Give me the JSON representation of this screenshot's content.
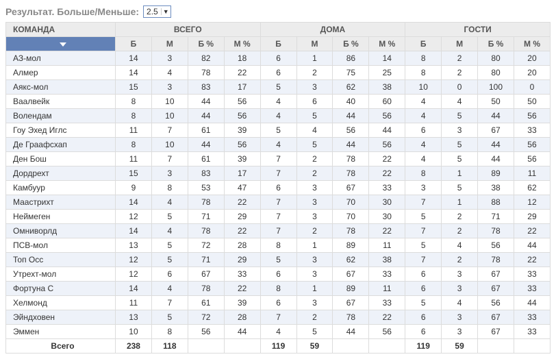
{
  "header": {
    "title": "Результат. Больше/Меньше:",
    "select_value": "2.5"
  },
  "columns": {
    "team": "КОМАНДА",
    "groups": [
      "ВСЕГО",
      "ДОМА",
      "ГОСТИ"
    ],
    "sub": [
      "Б",
      "М",
      "Б %",
      "М %"
    ]
  },
  "rows": [
    {
      "team": "АЗ-мол",
      "all": [
        14,
        3,
        82,
        18
      ],
      "home": [
        6,
        1,
        86,
        14
      ],
      "away": [
        8,
        2,
        80,
        20
      ]
    },
    {
      "team": "Алмер",
      "all": [
        14,
        4,
        78,
        22
      ],
      "home": [
        6,
        2,
        75,
        25
      ],
      "away": [
        8,
        2,
        80,
        20
      ]
    },
    {
      "team": "Аякс-мол",
      "all": [
        15,
        3,
        83,
        17
      ],
      "home": [
        5,
        3,
        62,
        38
      ],
      "away": [
        10,
        0,
        100,
        0
      ]
    },
    {
      "team": "Ваалвейк",
      "all": [
        8,
        10,
        44,
        56
      ],
      "home": [
        4,
        6,
        40,
        60
      ],
      "away": [
        4,
        4,
        50,
        50
      ]
    },
    {
      "team": "Волендам",
      "all": [
        8,
        10,
        44,
        56
      ],
      "home": [
        4,
        5,
        44,
        56
      ],
      "away": [
        4,
        5,
        44,
        56
      ]
    },
    {
      "team": "Гоу Эхед Иглс",
      "all": [
        11,
        7,
        61,
        39
      ],
      "home": [
        5,
        4,
        56,
        44
      ],
      "away": [
        6,
        3,
        67,
        33
      ]
    },
    {
      "team": "Де Граафсхап",
      "all": [
        8,
        10,
        44,
        56
      ],
      "home": [
        4,
        5,
        44,
        56
      ],
      "away": [
        4,
        5,
        44,
        56
      ]
    },
    {
      "team": "Ден Бош",
      "all": [
        11,
        7,
        61,
        39
      ],
      "home": [
        7,
        2,
        78,
        22
      ],
      "away": [
        4,
        5,
        44,
        56
      ]
    },
    {
      "team": "Дордрехт",
      "all": [
        15,
        3,
        83,
        17
      ],
      "home": [
        7,
        2,
        78,
        22
      ],
      "away": [
        8,
        1,
        89,
        11
      ]
    },
    {
      "team": "Камбуур",
      "all": [
        9,
        8,
        53,
        47
      ],
      "home": [
        6,
        3,
        67,
        33
      ],
      "away": [
        3,
        5,
        38,
        62
      ]
    },
    {
      "team": "Маастрихт",
      "all": [
        14,
        4,
        78,
        22
      ],
      "home": [
        7,
        3,
        70,
        30
      ],
      "away": [
        7,
        1,
        88,
        12
      ]
    },
    {
      "team": "Неймеген",
      "all": [
        12,
        5,
        71,
        29
      ],
      "home": [
        7,
        3,
        70,
        30
      ],
      "away": [
        5,
        2,
        71,
        29
      ]
    },
    {
      "team": "Омниворлд",
      "all": [
        14,
        4,
        78,
        22
      ],
      "home": [
        7,
        2,
        78,
        22
      ],
      "away": [
        7,
        2,
        78,
        22
      ]
    },
    {
      "team": "ПСВ-мол",
      "all": [
        13,
        5,
        72,
        28
      ],
      "home": [
        8,
        1,
        89,
        11
      ],
      "away": [
        5,
        4,
        56,
        44
      ]
    },
    {
      "team": "Топ Осс",
      "all": [
        12,
        5,
        71,
        29
      ],
      "home": [
        5,
        3,
        62,
        38
      ],
      "away": [
        7,
        2,
        78,
        22
      ]
    },
    {
      "team": "Утрехт-мол",
      "all": [
        12,
        6,
        67,
        33
      ],
      "home": [
        6,
        3,
        67,
        33
      ],
      "away": [
        6,
        3,
        67,
        33
      ]
    },
    {
      "team": "Фортуна С",
      "all": [
        14,
        4,
        78,
        22
      ],
      "home": [
        8,
        1,
        89,
        11
      ],
      "away": [
        6,
        3,
        67,
        33
      ]
    },
    {
      "team": "Хелмонд",
      "all": [
        11,
        7,
        61,
        39
      ],
      "home": [
        6,
        3,
        67,
        33
      ],
      "away": [
        5,
        4,
        56,
        44
      ]
    },
    {
      "team": "Эйндховен",
      "all": [
        13,
        5,
        72,
        28
      ],
      "home": [
        7,
        2,
        78,
        22
      ],
      "away": [
        6,
        3,
        67,
        33
      ]
    },
    {
      "team": "Эммен",
      "all": [
        10,
        8,
        56,
        44
      ],
      "home": [
        4,
        5,
        44,
        56
      ],
      "away": [
        6,
        3,
        67,
        33
      ]
    }
  ],
  "totals": {
    "label": "Всего",
    "all": [
      238,
      118,
      "",
      ""
    ],
    "home": [
      119,
      59,
      "",
      ""
    ],
    "away": [
      119,
      59,
      "",
      ""
    ]
  },
  "chart_data": {
    "type": "table",
    "title": "Результат. Больше/Меньше: 2.5",
    "columns": [
      "Команда",
      "Всего Б",
      "Всего М",
      "Всего Б%",
      "Всего М%",
      "Дома Б",
      "Дома М",
      "Дома Б%",
      "Дома М%",
      "Гости Б",
      "Гости М",
      "Гости Б%",
      "Гости М%"
    ],
    "rows": [
      [
        "АЗ-мол",
        14,
        3,
        82,
        18,
        6,
        1,
        86,
        14,
        8,
        2,
        80,
        20
      ],
      [
        "Алмер",
        14,
        4,
        78,
        22,
        6,
        2,
        75,
        25,
        8,
        2,
        80,
        20
      ],
      [
        "Аякс-мол",
        15,
        3,
        83,
        17,
        5,
        3,
        62,
        38,
        10,
        0,
        100,
        0
      ],
      [
        "Ваалвейк",
        8,
        10,
        44,
        56,
        4,
        6,
        40,
        60,
        4,
        4,
        50,
        50
      ],
      [
        "Волендам",
        8,
        10,
        44,
        56,
        4,
        5,
        44,
        56,
        4,
        5,
        44,
        56
      ],
      [
        "Гоу Эхед Иглс",
        11,
        7,
        61,
        39,
        5,
        4,
        56,
        44,
        6,
        3,
        67,
        33
      ],
      [
        "Де Граафсхап",
        8,
        10,
        44,
        56,
        4,
        5,
        44,
        56,
        4,
        5,
        44,
        56
      ],
      [
        "Ден Бош",
        11,
        7,
        61,
        39,
        7,
        2,
        78,
        22,
        4,
        5,
        44,
        56
      ],
      [
        "Дордрехт",
        15,
        3,
        83,
        17,
        7,
        2,
        78,
        22,
        8,
        1,
        89,
        11
      ],
      [
        "Камбуур",
        9,
        8,
        53,
        47,
        6,
        3,
        67,
        33,
        3,
        5,
        38,
        62
      ],
      [
        "Маастрихт",
        14,
        4,
        78,
        22,
        7,
        3,
        70,
        30,
        7,
        1,
        88,
        12
      ],
      [
        "Неймеген",
        12,
        5,
        71,
        29,
        7,
        3,
        70,
        30,
        5,
        2,
        71,
        29
      ],
      [
        "Омниворлд",
        14,
        4,
        78,
        22,
        7,
        2,
        78,
        22,
        7,
        2,
        78,
        22
      ],
      [
        "ПСВ-мол",
        13,
        5,
        72,
        28,
        8,
        1,
        89,
        11,
        5,
        4,
        56,
        44
      ],
      [
        "Топ Осс",
        12,
        5,
        71,
        29,
        5,
        3,
        62,
        38,
        7,
        2,
        78,
        22
      ],
      [
        "Утрехт-мол",
        12,
        6,
        67,
        33,
        6,
        3,
        67,
        33,
        6,
        3,
        67,
        33
      ],
      [
        "Фортуна С",
        14,
        4,
        78,
        22,
        8,
        1,
        89,
        11,
        6,
        3,
        67,
        33
      ],
      [
        "Хелмонд",
        11,
        7,
        61,
        39,
        6,
        3,
        67,
        33,
        5,
        4,
        56,
        44
      ],
      [
        "Эйндховен",
        13,
        5,
        72,
        28,
        7,
        2,
        78,
        22,
        6,
        3,
        67,
        33
      ],
      [
        "Эммен",
        10,
        8,
        56,
        44,
        4,
        5,
        44,
        56,
        6,
        3,
        67,
        33
      ],
      [
        "Всего",
        238,
        118,
        null,
        null,
        119,
        59,
        null,
        null,
        119,
        59,
        null,
        null
      ]
    ]
  }
}
